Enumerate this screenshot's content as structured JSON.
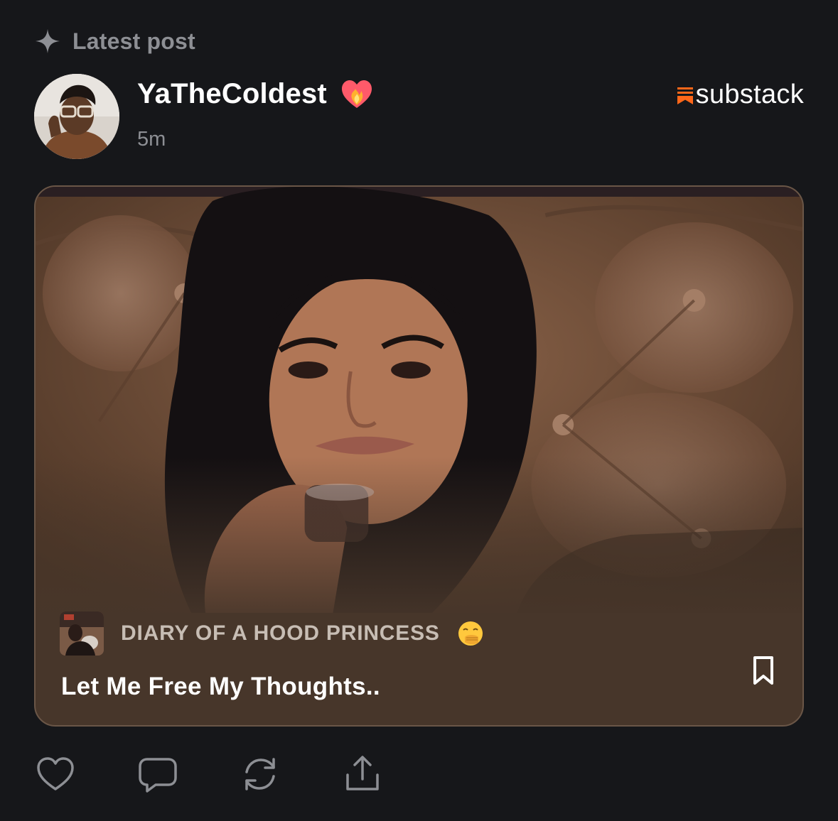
{
  "header": {
    "label": "Latest post",
    "icon": "sparkle-icon"
  },
  "author": {
    "name": "YaTheColdest",
    "emoji": "heart-on-fire",
    "time": "5m"
  },
  "brand": {
    "label": "substack",
    "accent": "#ff6719"
  },
  "card": {
    "publication": "DIARY OF A HOOD PRINCESS",
    "publication_emoji": "face-with-hand-over-mouth",
    "title": "Let Me Free My Thoughts..",
    "bookmark_icon": "bookmark-icon"
  },
  "actions": [
    "heart-icon",
    "comment-icon",
    "restack-icon",
    "share-icon"
  ],
  "colors": {
    "background": "#16171a",
    "muted_text": "#8d8f94",
    "card_bg": "#47362a"
  }
}
